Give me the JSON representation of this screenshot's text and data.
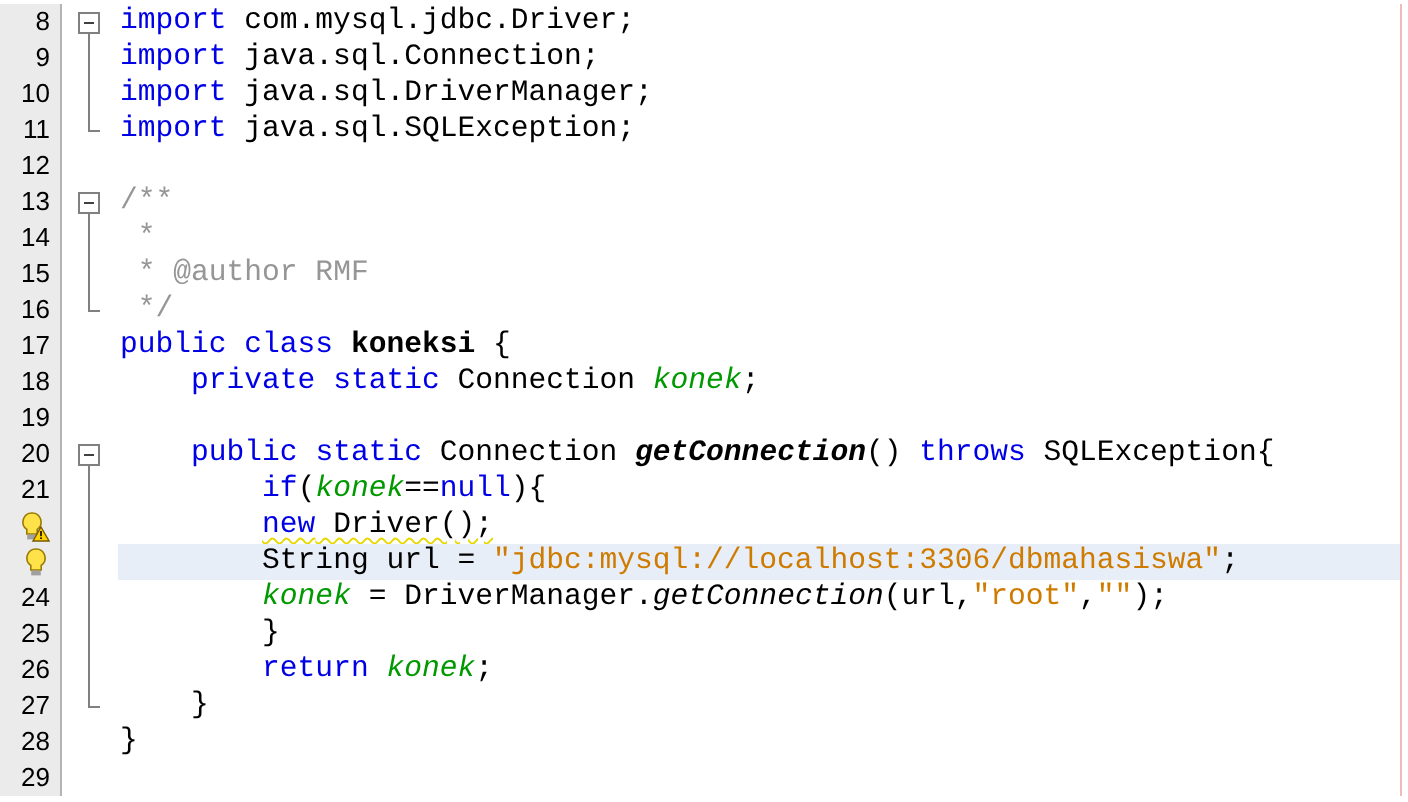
{
  "lines": [
    {
      "number": "8",
      "fold": {
        "kind": "start"
      },
      "selected": false,
      "tokens": [
        {
          "text": "import",
          "kind": "keyword"
        },
        {
          "text": " com.mysql.jdbc.Driver;",
          "kind": "plain"
        }
      ]
    },
    {
      "number": "9",
      "fold": {
        "kind": "line"
      },
      "selected": false,
      "tokens": [
        {
          "text": "import",
          "kind": "keyword"
        },
        {
          "text": " java.sql.Connection;",
          "kind": "plain"
        }
      ]
    },
    {
      "number": "10",
      "fold": {
        "kind": "line"
      },
      "selected": false,
      "tokens": [
        {
          "text": "import",
          "kind": "keyword"
        },
        {
          "text": " java.sql.DriverManager;",
          "kind": "plain"
        }
      ]
    },
    {
      "number": "11",
      "fold": {
        "kind": "end"
      },
      "selected": false,
      "tokens": [
        {
          "text": "import",
          "kind": "keyword"
        },
        {
          "text": " java.sql.SQLException;",
          "kind": "plain"
        }
      ]
    },
    {
      "number": "12",
      "selected": false
    },
    {
      "number": "13",
      "fold": {
        "kind": "start"
      },
      "selected": false,
      "tokens": [
        {
          "text": "/**",
          "kind": "comment"
        }
      ]
    },
    {
      "number": "14",
      "fold": {
        "kind": "line"
      },
      "selected": false,
      "tokens": [
        {
          "text": " *",
          "kind": "comment"
        }
      ]
    },
    {
      "number": "15",
      "fold": {
        "kind": "line"
      },
      "selected": false,
      "tokens": [
        {
          "text": " * @author RMF",
          "kind": "comment"
        }
      ]
    },
    {
      "number": "16",
      "fold": {
        "kind": "end"
      },
      "selected": false,
      "tokens": [
        {
          "text": " */",
          "kind": "comment"
        }
      ]
    },
    {
      "number": "17",
      "selected": false,
      "tokens": [
        {
          "text": "public class ",
          "kind": "keyword"
        },
        {
          "text": "koneksi",
          "kind": "declaration"
        },
        {
          "text": " {",
          "kind": "plain"
        }
      ]
    },
    {
      "number": "18",
      "selected": false,
      "tokens": [
        {
          "text": "    private static",
          "kind": "keyword"
        },
        {
          "text": " Connection ",
          "kind": "plain"
        },
        {
          "text": "konek",
          "kind": "field"
        },
        {
          "text": ";",
          "kind": "plain"
        }
      ]
    },
    {
      "number": "19",
      "selected": false
    },
    {
      "number": "20",
      "fold": {
        "kind": "start"
      },
      "selected": false,
      "tokens": [
        {
          "text": "    public static",
          "kind": "keyword"
        },
        {
          "text": " Connection ",
          "kind": "plain"
        },
        {
          "text": "getConnection",
          "kind": "method-declaration"
        },
        {
          "text": "() ",
          "kind": "plain"
        },
        {
          "text": "throws",
          "kind": "keyword"
        },
        {
          "text": " SQLException{",
          "kind": "plain"
        }
      ]
    },
    {
      "number": "21",
      "fold": {
        "kind": "line"
      },
      "selected": false,
      "tokens": [
        {
          "text": "        if",
          "kind": "keyword"
        },
        {
          "text": "(",
          "kind": "plain"
        },
        {
          "text": "konek",
          "kind": "field"
        },
        {
          "text": "==",
          "kind": "plain"
        },
        {
          "text": "null",
          "kind": "keyword"
        },
        {
          "text": "){",
          "kind": "plain"
        }
      ]
    },
    {
      "hint": {
        "kind": "warning-bulb"
      },
      "fold": {
        "kind": "line"
      },
      "selected": false,
      "squiggle": true,
      "tokens": [
        {
          "text": "        new",
          "kind": "keyword"
        },
        {
          "text": " Driver();",
          "kind": "plain"
        }
      ]
    },
    {
      "hint": {
        "kind": "bulb"
      },
      "fold": {
        "kind": "line"
      },
      "selected": true,
      "squiggle": false,
      "tokens": [
        {
          "text": "        String url = ",
          "kind": "plain"
        },
        {
          "text": "\"jdbc:mysql://localhost:3306/dbmahasiswa\"",
          "kind": "string"
        },
        {
          "text": ";",
          "kind": "plain"
        }
      ]
    },
    {
      "number": "24",
      "fold": {
        "kind": "line"
      },
      "selected": false,
      "tokens": [
        {
          "text": "        konek",
          "kind": "field"
        },
        {
          "text": " = DriverManager.",
          "kind": "plain"
        },
        {
          "text": "getConnection",
          "kind": "method-call"
        },
        {
          "text": "(url,",
          "kind": "plain"
        },
        {
          "text": "\"root\"",
          "kind": "string"
        },
        {
          "text": ",",
          "kind": "plain"
        },
        {
          "text": "\"\"",
          "kind": "string"
        },
        {
          "text": ");",
          "kind": "plain"
        }
      ]
    },
    {
      "number": "25",
      "fold": {
        "kind": "line"
      },
      "selected": false,
      "tokens": [
        {
          "text": "        }",
          "kind": "plain"
        }
      ]
    },
    {
      "number": "26",
      "fold": {
        "kind": "line"
      },
      "selected": false,
      "tokens": [
        {
          "text": "        return ",
          "kind": "keyword"
        },
        {
          "text": "konek",
          "kind": "field"
        },
        {
          "text": ";",
          "kind": "plain"
        }
      ]
    },
    {
      "number": "27",
      "fold": {
        "kind": "end"
      },
      "selected": false,
      "tokens": [
        {
          "text": "    }",
          "kind": "plain"
        }
      ]
    },
    {
      "number": "28",
      "selected": false,
      "tokens": [
        {
          "text": "}",
          "kind": "plain"
        }
      ]
    },
    {
      "number": "29",
      "selected": false
    }
  ]
}
